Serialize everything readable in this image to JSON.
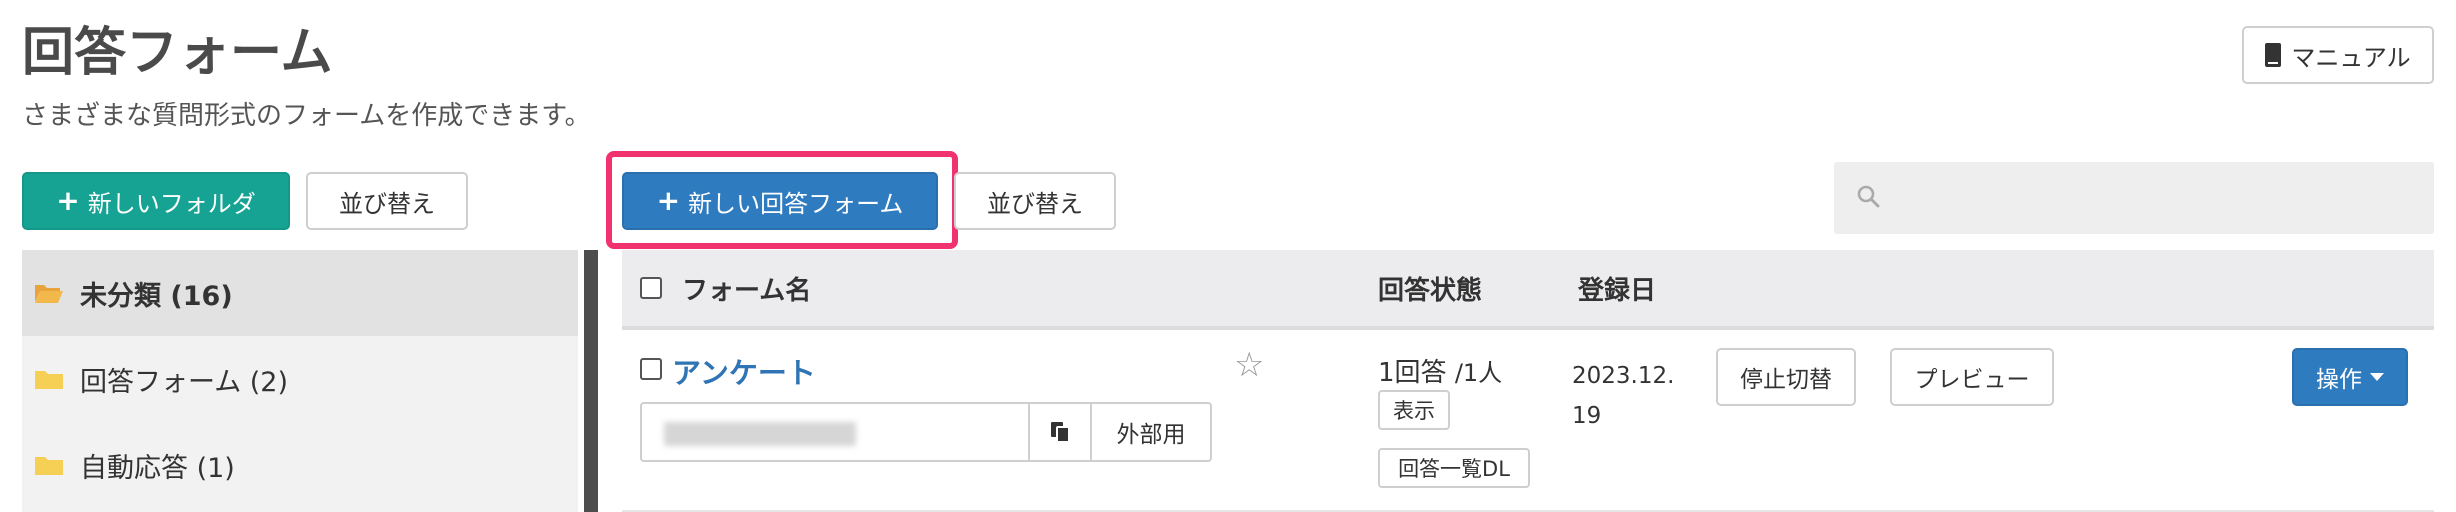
{
  "page": {
    "title": "回答フォーム",
    "subtitle": "さまざまな質問形式のフォームを作成できます。"
  },
  "header": {
    "manual_label": "マニュアル"
  },
  "folder_toolbar": {
    "new_folder_label": "新しいフォルダ",
    "sort_label": "並び替え"
  },
  "form_toolbar": {
    "new_form_label": "新しい回答フォーム",
    "sort_label": "並び替え",
    "search_placeholder": ""
  },
  "sidebar": {
    "items": [
      {
        "label": "未分類 (16)",
        "active": true
      },
      {
        "label": "回答フォーム (2)",
        "active": false
      },
      {
        "label": "自動応答 (1)",
        "active": false
      }
    ]
  },
  "table": {
    "headers": {
      "name": "フォーム名",
      "status": "回答状態",
      "date": "登録日"
    },
    "rows": [
      {
        "name": "アンケート",
        "external_label": "外部用",
        "responses": "1回答",
        "responders": "/1人",
        "show_label": "表示",
        "download_label": "回答一覧DL",
        "date": "2023.12. 19",
        "stop_label": "停止切替",
        "preview_label": "プレビュー",
        "operation_label": "操作"
      }
    ]
  },
  "colors": {
    "teal": "#16a394",
    "blue": "#2f7bbf",
    "highlight": "#f0326e",
    "folder_open": "#e8a33a",
    "folder_closed": "#f6cf55"
  },
  "icons": {
    "manual": "book-icon",
    "search": "search-icon",
    "folder_open": "folder-open-icon",
    "folder": "folder-icon",
    "copy": "copy-icon",
    "star": "star-icon",
    "operation": "caret-down-icon"
  }
}
